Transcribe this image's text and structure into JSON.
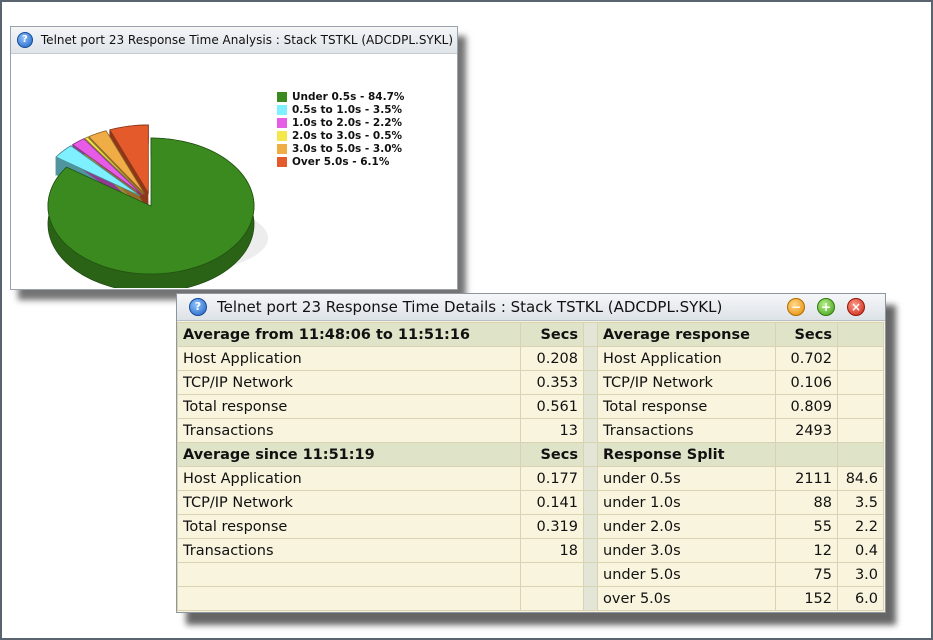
{
  "chart_window": {
    "title": "Telnet port 23 Response Time Analysis : Stack TSTKL (ADCDPL.SYKL)",
    "help_icon": "question-icon"
  },
  "chart_data": {
    "type": "pie",
    "title": "Telnet port 23 Response Time Analysis : Stack TSTKL (ADCDPL.SYKL)",
    "categories": [
      "Under 0.5s",
      "0.5s to 1.0s",
      "1.0s to 2.0s",
      "2.0s to 3.0s",
      "3.0s to 5.0s",
      "Over 5.0s"
    ],
    "values": [
      84.7,
      3.5,
      2.2,
      0.5,
      3.0,
      6.1
    ],
    "colors": [
      "#3b8a1f",
      "#7ff0ff",
      "#e65ce6",
      "#f5e64a",
      "#f0ac45",
      "#e55a2a"
    ],
    "legend_labels": [
      "Under 0.5s - 84.7%",
      "0.5s to 1.0s - 3.5%",
      "1.0s to 2.0s - 2.2%",
      "2.0s to 3.0s - 0.5%",
      "3.0s to 5.0s - 3.0%",
      "Over 5.0s - 6.1%"
    ],
    "legend_position": "right",
    "exploded_slices": [
      "0.5s to 1.0s",
      "1.0s to 2.0s",
      "2.0s to 3.0s",
      "3.0s to 5.0s",
      "Over 5.0s"
    ]
  },
  "details_window": {
    "title": "Telnet port 23 Response Time Details : Stack TSTKL (ADCDPL.SYKL)",
    "buttons": {
      "minimize": "−",
      "maximize": "+",
      "close": "×"
    },
    "rows": [
      {
        "hdr": true,
        "l": "Average from 11:48:06 to 11:51:16",
        "lv": "Secs",
        "r": "Average response",
        "rv": "Secs",
        "rp": ""
      },
      {
        "hdr": false,
        "l": "Host Application",
        "lv": "0.208",
        "r": "Host Application",
        "rv": "0.702",
        "rp": ""
      },
      {
        "hdr": false,
        "l": "TCP/IP Network",
        "lv": "0.353",
        "r": "TCP/IP Network",
        "rv": "0.106",
        "rp": ""
      },
      {
        "hdr": false,
        "l": "Total response",
        "lv": "0.561",
        "r": "Total response",
        "rv": "0.809",
        "rp": ""
      },
      {
        "hdr": false,
        "l": "Transactions",
        "lv": "13",
        "r": "Transactions",
        "rv": "2493",
        "rp": ""
      },
      {
        "hdr": true,
        "l": "Average since 11:51:19",
        "lv": "Secs",
        "r": "Response Split",
        "rv": "",
        "rp": ""
      },
      {
        "hdr": false,
        "l": "Host Application",
        "lv": "0.177",
        "r": "under 0.5s",
        "rv": "2111",
        "rp": "84.6"
      },
      {
        "hdr": false,
        "l": "TCP/IP Network",
        "lv": "0.141",
        "r": "under 1.0s",
        "rv": "88",
        "rp": "3.5"
      },
      {
        "hdr": false,
        "l": "Total response",
        "lv": "0.319",
        "r": "under 2.0s",
        "rv": "55",
        "rp": "2.2"
      },
      {
        "hdr": false,
        "l": "Transactions",
        "lv": "18",
        "r": "under 3.0s",
        "rv": "12",
        "rp": "0.4"
      },
      {
        "hdr": false,
        "l": "",
        "lv": "",
        "r": "under 5.0s",
        "rv": "75",
        "rp": "3.0"
      },
      {
        "hdr": false,
        "l": "",
        "lv": "",
        "r": "over 5.0s",
        "rv": "152",
        "rp": "6.0"
      }
    ]
  }
}
